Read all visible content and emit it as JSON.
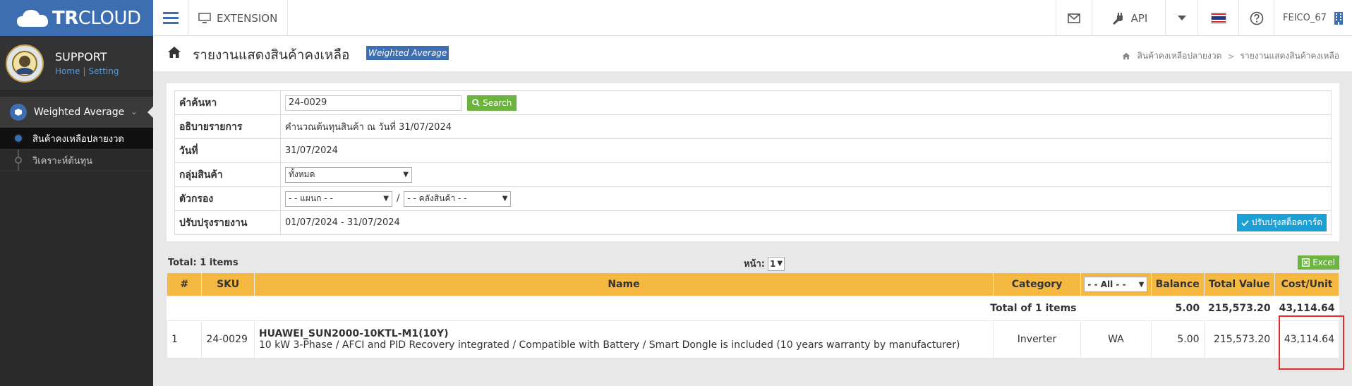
{
  "app": {
    "logo": "TRCLOUD",
    "extension_label": "EXTENSION",
    "api_label": "API",
    "user": "FEICO_67"
  },
  "sidebar": {
    "profile_name": "SUPPORT",
    "home_link": "Home",
    "setting_link": "Setting",
    "menu_title": "Weighted Average",
    "items": [
      {
        "label": "สินค้าคงเหลือปลายงวด",
        "active": true
      },
      {
        "label": "วิเคราะห์ต้นทุน",
        "active": false
      }
    ]
  },
  "page": {
    "title": "รายงานแสดงสินค้าคงเหลือ",
    "badge": "Weighted Average",
    "breadcrumb": [
      "สินค้าคงเหลือปลายงวด",
      "รายงานแสดงสินค้าคงเหลือ"
    ]
  },
  "form": {
    "search_label": "คำค้นหา",
    "search_value": "24-0029",
    "search_button": "Search",
    "desc_label": "อธิบายรายการ",
    "desc_value": "คำนวณต้นทุนสินค้า ณ วันที่ 31/07/2024",
    "date_label": "วันที่",
    "date_value": "31/07/2024",
    "group_label": "กลุ่มสินค้า",
    "group_value": "ทั้งหมด",
    "filter_label": "ตัวกรอง",
    "filter_dept": "- - แผนก - -",
    "filter_warehouse": "- - คลังสินค้า - -",
    "update_label": "ปรับปรุงรายงาน",
    "update_value": "01/07/2024 - 31/07/2024",
    "update_button": "ปรับปรุงสต็อคการ์ด"
  },
  "list": {
    "total_items": "Total: 1 items",
    "page_label": "หน้า:",
    "page_value": "1",
    "excel_button": "Excel"
  },
  "table": {
    "headers": {
      "num": "#",
      "sku": "SKU",
      "name": "Name",
      "category": "Category",
      "filter_all": "- - All - -",
      "balance": "Balance",
      "total_value": "Total Value",
      "cost_unit": "Cost/Unit"
    },
    "total_row": {
      "label": "Total of 1 items",
      "balance": "5.00",
      "total_value": "215,573.20",
      "cost_unit": "43,114.64"
    },
    "rows": [
      {
        "num": "1",
        "sku": "24-0029",
        "name": "HUAWEI_SUN2000-10KTL-M1(10Y)",
        "description": "10 kW 3-Phase / AFCI and PID Recovery integrated / Compatible with Battery / Smart Dongle is included (10 years warranty by manufacturer)",
        "category": "Inverter",
        "method": "WA",
        "balance": "5.00",
        "total_value": "215,573.20",
        "cost_unit": "43,114.64"
      }
    ]
  },
  "colors": {
    "brand": "#3d6eb2",
    "table_header": "#f5b942",
    "success": "#6db33f",
    "info": "#1ba1d6",
    "highlight": "#e02b2b"
  }
}
